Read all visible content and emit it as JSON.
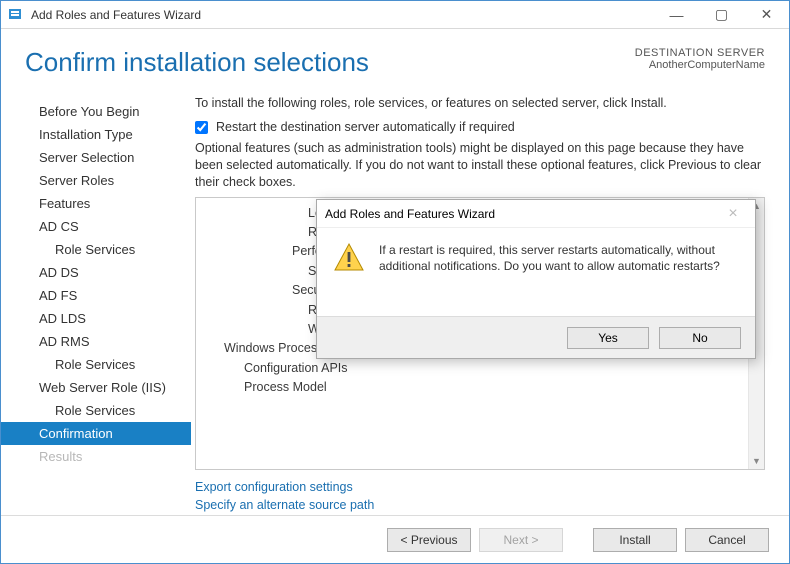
{
  "window": {
    "title": "Add Roles and Features Wizard"
  },
  "header": {
    "heading": "Confirm installation selections",
    "dest_label": "DESTINATION SERVER",
    "dest_value": "AnotherComputerName"
  },
  "sidebar": {
    "items": [
      {
        "label": "Before You Begin"
      },
      {
        "label": "Installation Type"
      },
      {
        "label": "Server Selection"
      },
      {
        "label": "Server Roles"
      },
      {
        "label": "Features"
      },
      {
        "label": "AD CS"
      },
      {
        "label": "Role Services",
        "sub": true
      },
      {
        "label": "AD DS"
      },
      {
        "label": "AD FS"
      },
      {
        "label": "AD LDS"
      },
      {
        "label": "AD RMS"
      },
      {
        "label": "Role Services",
        "sub": true
      },
      {
        "label": "Web Server Role (IIS)"
      },
      {
        "label": "Role Services",
        "sub": true
      },
      {
        "label": "Confirmation",
        "selected": true
      },
      {
        "label": "Results",
        "disabled": true
      }
    ]
  },
  "main": {
    "intro": "To install the following roles, role services, or features on selected server, click Install.",
    "restart_checkbox": "Restart the destination server automatically if required",
    "note": "Optional features (such as administration tools) might be displayed on this page because they have been selected automatically. If you do not want to install these optional features, click Previous to clear their check boxes.",
    "features": [
      {
        "label": "Logg",
        "lvl": 2
      },
      {
        "label": "Requ",
        "lvl": 2
      },
      {
        "label": "Performa",
        "lvl": 1
      },
      {
        "label": "Stat",
        "lvl": 2
      },
      {
        "label": "Security",
        "lvl": 1
      },
      {
        "label": "Requ",
        "lvl": 2
      },
      {
        "label": "Windows Authentication",
        "lvl": 2
      },
      {
        "label": "Windows Process Activation Service",
        "lvl": 0
      },
      {
        "label": "Configuration APIs",
        "lvl": 1
      },
      {
        "label": "Process Model",
        "lvl": 1
      }
    ],
    "links": {
      "export": "Export configuration settings",
      "altpath": "Specify an alternate source path"
    }
  },
  "footer": {
    "previous": "< Previous",
    "next": "Next >",
    "install": "Install",
    "cancel": "Cancel"
  },
  "dialog": {
    "title": "Add Roles and Features Wizard",
    "message": "If a restart is required, this server restarts automatically, without additional notifications. Do you want to allow automatic restarts?",
    "yes": "Yes",
    "no": "No"
  }
}
